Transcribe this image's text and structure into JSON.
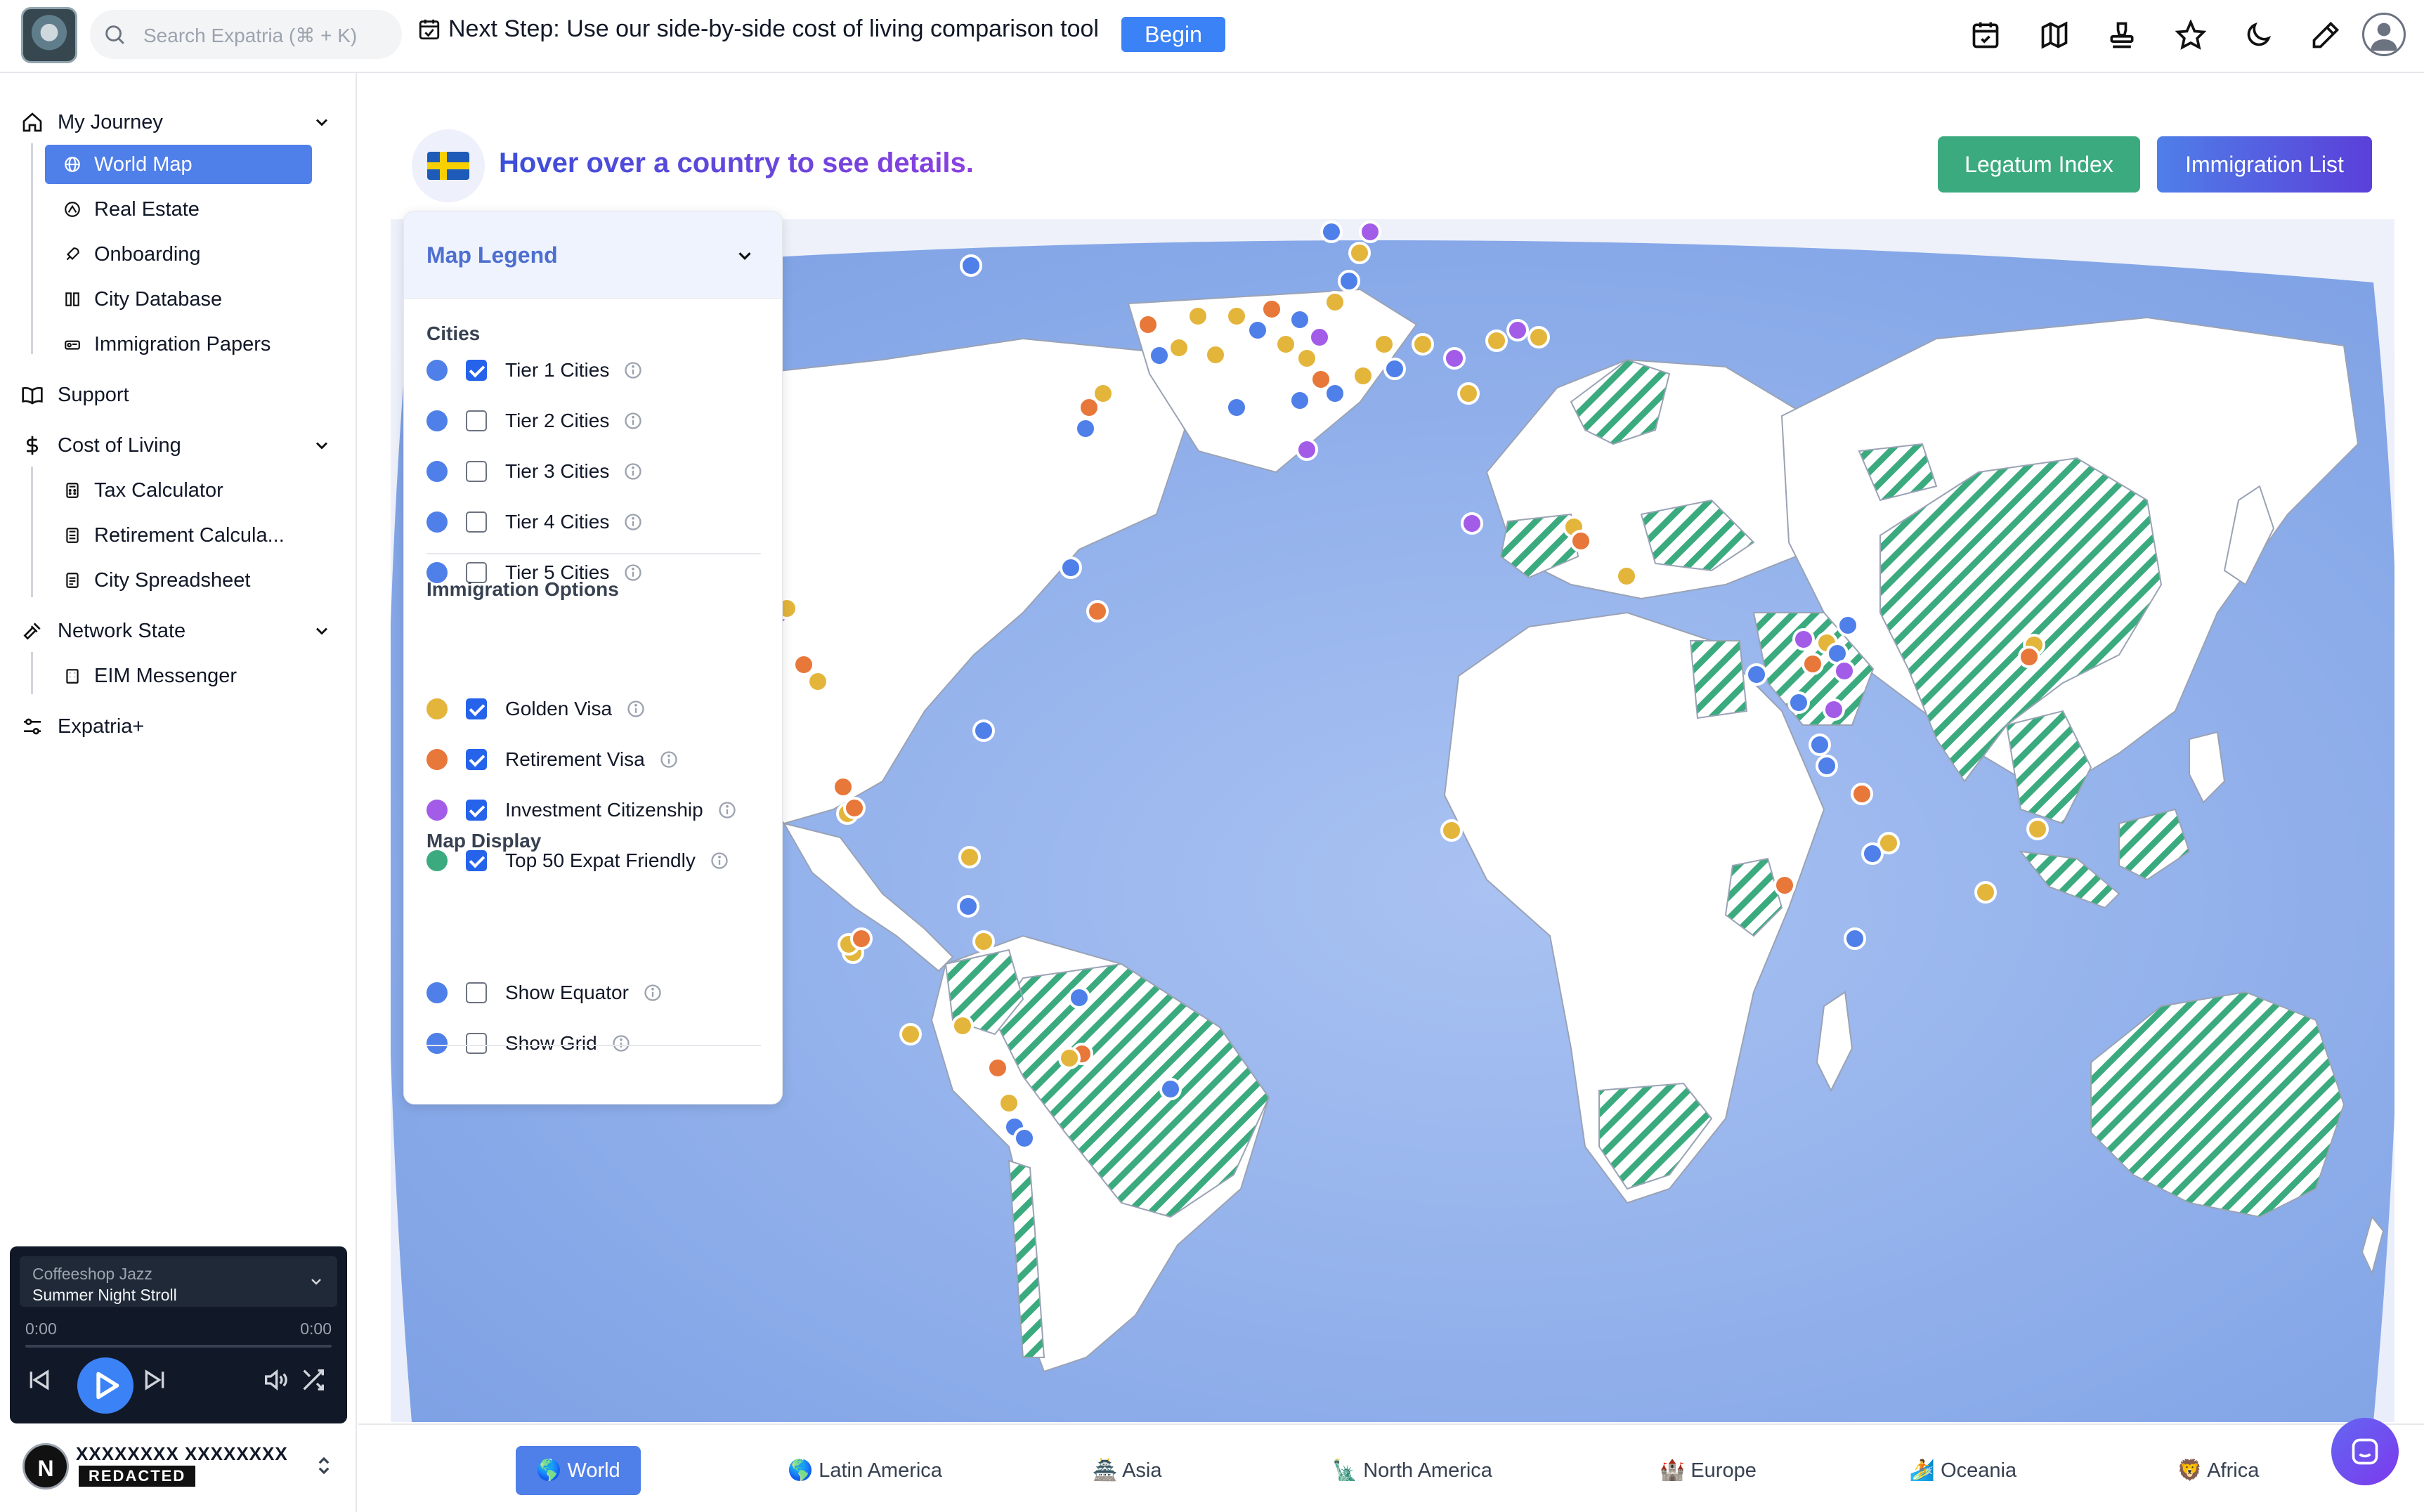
{
  "topbar": {
    "search_placeholder": "Search Expatria (⌘ + K)",
    "next_step": "Next Step: Use our side-by-side cost of living comparison tool",
    "begin_label": "Begin",
    "icons": [
      "calendar-check-icon",
      "map-icon",
      "stamp-icon",
      "star-icon",
      "moon-icon",
      "pencil-icon",
      "user-avatar-icon"
    ]
  },
  "sidebar": {
    "sections": [
      {
        "label": "My Journey",
        "icon": "home-icon",
        "expanded": true,
        "items": [
          {
            "label": "World Map",
            "icon": "globe-icon",
            "active": true
          },
          {
            "label": "Real Estate",
            "icon": "building-icon"
          },
          {
            "label": "Onboarding",
            "icon": "rocket-icon"
          },
          {
            "label": "City Database",
            "icon": "book-icon"
          },
          {
            "label": "Immigration Papers",
            "icon": "passport-icon"
          }
        ]
      },
      {
        "label": "Support",
        "icon": "book-open-icon"
      },
      {
        "label": "Cost of Living",
        "icon": "dollar-icon",
        "expanded": true,
        "items": [
          {
            "label": "Tax Calculator",
            "icon": "calculator-icon"
          },
          {
            "label": "Retirement Calcula...",
            "icon": "calculator-icon"
          },
          {
            "label": "City Spreadsheet",
            "icon": "sheet-icon"
          }
        ]
      },
      {
        "label": "Network State",
        "icon": "gavel-icon",
        "expanded": true,
        "items": [
          {
            "label": "EIM Messenger",
            "icon": "building-icon"
          }
        ]
      },
      {
        "label": "Expatria+",
        "icon": "sliders-icon"
      }
    ]
  },
  "player": {
    "playlist": "Coffeeshop Jazz",
    "track": "Summer Night Stroll",
    "time_current": "0:00",
    "time_total": "0:00",
    "progress": 0
  },
  "user": {
    "avatar_letter": "N",
    "name": "XXXXXXXX XXXXXXXX",
    "badge": "REDACTED"
  },
  "main": {
    "hover_text": "Hover over a country to see details.",
    "btn_legatum": "Legatum Index",
    "btn_immigration": "Immigration List"
  },
  "legend": {
    "title": "Map Legend",
    "cities_title": "Cities",
    "cities": [
      {
        "label": "Tier 1 Cities",
        "checked": true,
        "color": "#4f7fe8"
      },
      {
        "label": "Tier 2 Cities",
        "checked": false,
        "color": "#4f7fe8"
      },
      {
        "label": "Tier 3 Cities",
        "checked": false,
        "color": "#4f7fe8"
      },
      {
        "label": "Tier 4 Cities",
        "checked": false,
        "color": "#4f7fe8"
      },
      {
        "label": "Tier 5 Cities",
        "checked": false,
        "color": "#4f7fe8"
      }
    ],
    "immigration_title": "Immigration Options",
    "immigration": [
      {
        "label": "Golden Visa",
        "checked": true,
        "color": "#e3b53b"
      },
      {
        "label": "Retirement Visa",
        "checked": true,
        "color": "#e8773a"
      },
      {
        "label": "Investment Citizenship",
        "checked": true,
        "color": "#a35ce8"
      },
      {
        "label": "Top 50 Expat Friendly",
        "checked": true,
        "color": "#3bab7f"
      }
    ],
    "display_title": "Map Display",
    "display": [
      {
        "label": "Show Equator",
        "checked": false,
        "color": "#4f7fe8"
      },
      {
        "label": "Show Grid",
        "checked": false,
        "color": "#4f7fe8"
      }
    ]
  },
  "bottomnav": [
    {
      "label": "🌎 World",
      "active": true
    },
    {
      "label": "🌎 Latin America"
    },
    {
      "label": "🏯 Asia"
    },
    {
      "label": "🗽 North America"
    },
    {
      "label": "🏰 Europe"
    },
    {
      "label": "🏄 Oceania"
    },
    {
      "label": "🦁 Africa"
    }
  ],
  "colors": {
    "accent": "#4f7fe8",
    "ocean": "#8fb0ea",
    "land": "#ffffff",
    "hatch": "#3bab7f",
    "tier1": "#4f7fe8",
    "golden": "#e3b53b",
    "retirement": "#e8773a",
    "citizenship": "#a35ce8"
  }
}
